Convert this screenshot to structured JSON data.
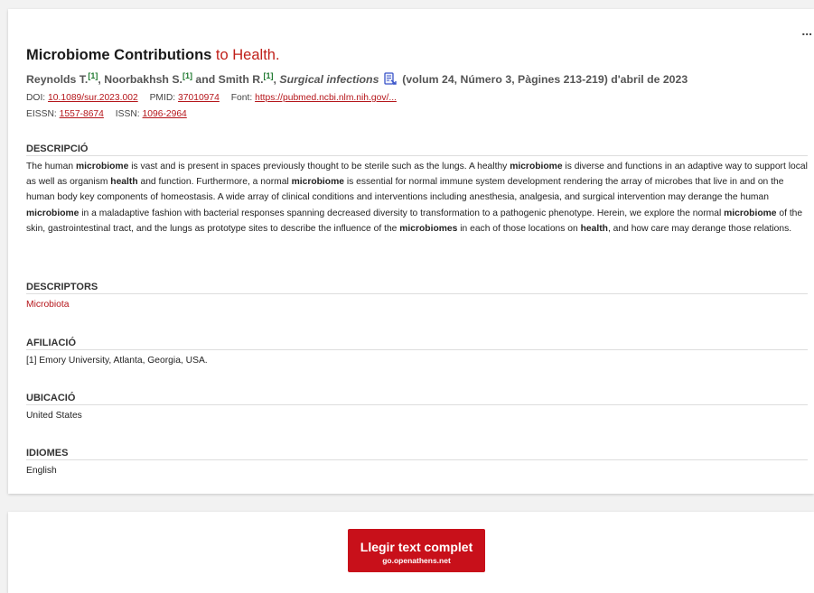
{
  "record": {
    "menu_label": "...",
    "title_bold": "Microbiome Contributions",
    "title_rest": " to Health.",
    "authors": [
      {
        "name": "Reynolds T.",
        "ref": "[1]"
      },
      {
        "name": "Noorbakhsh S.",
        "ref": "[1]"
      },
      {
        "name": "Smith R.",
        "ref": "[1]"
      }
    ],
    "sep_comma": ", ",
    "sep_and": " and ",
    "journal": "Surgical infections",
    "volume_info": "(volum 24, Número 3, Pàgines 213-219) d'abril de 2023",
    "doc_icon": "document-link-icon",
    "doi_label": "DOI:",
    "doi": "10.1089/sur.2023.002",
    "pmid_label": "PMID:",
    "pmid": "37010974",
    "font_label": "Font:",
    "font_url": "https://pubmed.ncbi.nlm.nih.gov/...",
    "eissn_label": "EISSN:",
    "eissn": "1557-8674",
    "issn_label": "ISSN:",
    "issn": "1096-2964"
  },
  "description": {
    "heading": "DESCRIPCIÓ",
    "segments": [
      {
        "t": "The human ",
        "b": false
      },
      {
        "t": "microbiome",
        "b": true
      },
      {
        "t": " is vast and is present in spaces previously thought to be sterile such as the lungs. A healthy ",
        "b": false
      },
      {
        "t": "microbiome",
        "b": true
      },
      {
        "t": " is diverse and functions in an adaptive way to support local as well as organism ",
        "b": false
      },
      {
        "t": "health",
        "b": true
      },
      {
        "t": " and function. Furthermore, a normal ",
        "b": false
      },
      {
        "t": "microbiome",
        "b": true
      },
      {
        "t": " is essential for normal immune system development rendering the array of microbes that live in and on the human body key components of homeostasis. A wide array of clinical conditions and interventions including anesthesia, analgesia, and surgical intervention may derange the human ",
        "b": false
      },
      {
        "t": "microbiome",
        "b": true
      },
      {
        "t": " in a maladaptive fashion with bacterial responses spanning decreased diversity to transformation to a pathogenic phenotype. Herein, we explore the normal ",
        "b": false
      },
      {
        "t": "microbiome",
        "b": true
      },
      {
        "t": " of the skin, gastrointestinal tract, and the lungs as prototype sites to describe the influence of the ",
        "b": false
      },
      {
        "t": "microbiomes",
        "b": true
      },
      {
        "t": " in each of those locations on ",
        "b": false
      },
      {
        "t": "health",
        "b": true
      },
      {
        "t": ", and how care may derange those relations.",
        "b": false
      }
    ]
  },
  "descriptors": {
    "heading": "DESCRIPTORS",
    "value": "Microbiota",
    "color": "#b5161b"
  },
  "affiliation": {
    "heading": "AFILIACIÓ",
    "value": "[1] Emory University, Atlanta, Georgia, USA."
  },
  "location": {
    "heading": "UBICACIÓ",
    "value": "United States"
  },
  "languages": {
    "heading": "IDIOMES",
    "value": "English"
  },
  "fulltext_button": {
    "label": "Llegir text complet",
    "sublabel": "go.openathens.net",
    "color": "#c8101a"
  }
}
